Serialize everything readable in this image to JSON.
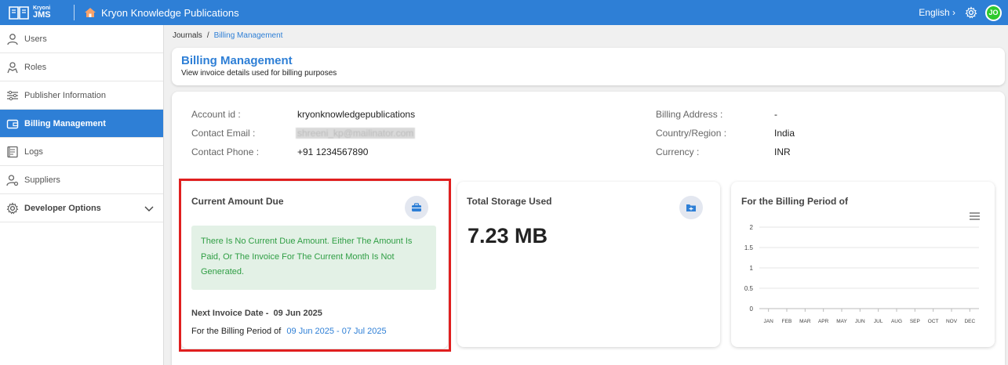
{
  "topbar": {
    "logo_top": "Kryoni",
    "logo_bottom": "JMS",
    "app_title": "Kryon Knowledge Publications",
    "language": "English",
    "avatar_initials": "JO"
  },
  "sidebar": {
    "items": [
      {
        "label": "Users",
        "icon": "user-icon"
      },
      {
        "label": "Roles",
        "icon": "roles-icon"
      },
      {
        "label": "Publisher Information",
        "icon": "sliders-icon"
      },
      {
        "label": "Billing Management",
        "icon": "wallet-icon",
        "active": true
      },
      {
        "label": "Logs",
        "icon": "logs-icon"
      },
      {
        "label": "Suppliers",
        "icon": "supplier-icon"
      },
      {
        "label": "Developer Options",
        "icon": "gear-icon"
      }
    ]
  },
  "breadcrumb": {
    "parent": "Journals",
    "separator": "/",
    "current": "Billing Management"
  },
  "header": {
    "title": "Billing Management",
    "subtitle": "View invoice details used for billing purposes"
  },
  "account": {
    "account_id_label": "Account id :",
    "account_id_value": "kryonknowledgepublications",
    "email_label": "Contact Email :",
    "email_value": "shreeni_kp@mailinator.com",
    "phone_label": "Contact Phone :",
    "phone_value": "+91 1234567890",
    "address_label": "Billing Address :",
    "address_value": "-",
    "country_label": "Country/Region :",
    "country_value": "India",
    "currency_label": "Currency :",
    "currency_value": "INR"
  },
  "current_due": {
    "title": "Current Amount Due",
    "notice": "There Is No Current Due Amount. Either The Amount Is Paid, Or The Invoice For The Current Month Is Not Generated.",
    "next_invoice_label": "Next Invoice Date -",
    "next_invoice_value": "09 Jun 2025",
    "billing_period_label": "For the Billing Period of",
    "billing_period_value": "09 Jun 2025 - 07 Jul 2025"
  },
  "storage": {
    "title": "Total Storage Used",
    "value": "7.23 MB"
  },
  "billing_chart": {
    "title": "For the Billing Period of"
  },
  "chart_data": {
    "type": "line",
    "title": "For the Billing Period of",
    "categories": [
      "JAN",
      "FEB",
      "MAR",
      "APR",
      "MAY",
      "JUN",
      "JUL",
      "AUG",
      "SEP",
      "OCT",
      "NOV",
      "DEC"
    ],
    "series": [],
    "y_ticks": [
      "2",
      "1.5",
      "1",
      "0.5",
      "0"
    ],
    "ylim": [
      0,
      2
    ],
    "grid": true
  },
  "colors": {
    "primary": "#2e7fd6",
    "highlight": "#e01f1f",
    "notice_bg": "#e3f1e6",
    "notice_text": "#2f9e44"
  }
}
